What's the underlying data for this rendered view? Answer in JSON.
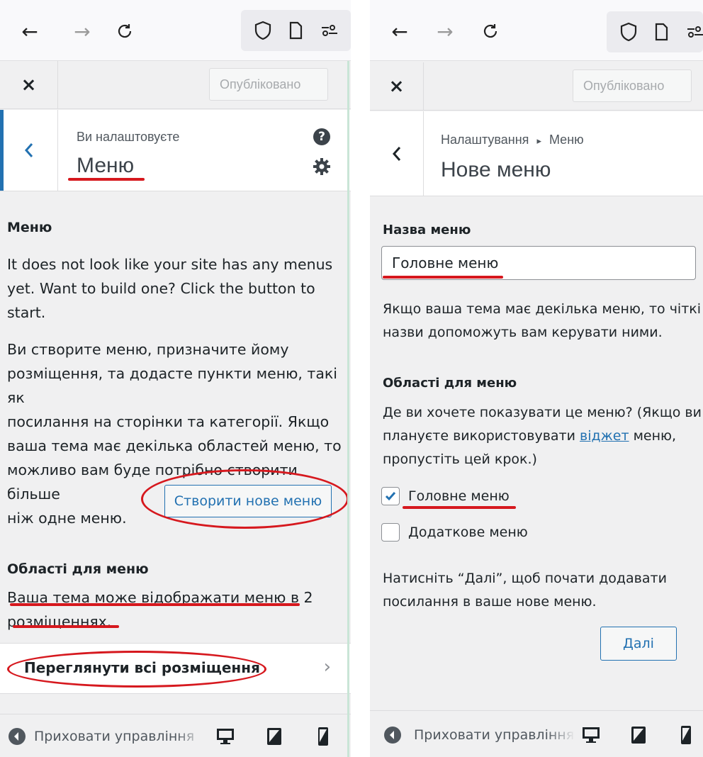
{
  "left_panel": {
    "header": {
      "close_label": "×",
      "published_label": "Опубліковано"
    },
    "section": {
      "subtitle": "Ви налаштовуєте",
      "title": "Меню"
    },
    "content": {
      "heading": "Меню",
      "paragraph1_lines": [
        "It does not look like your site has any menus",
        "yet. Want to build one? Click the button to",
        "start."
      ],
      "paragraph2_lines": [
        "Ви створите меню, призначите йому",
        "розміщення, та додасте пункти меню, такі як",
        "посилання на сторінки та категорії. Якщо",
        "ваша тема має декілька областей меню, то",
        "можливо вам буде потрібно створити більше",
        "ніж одне меню."
      ],
      "create_button_label": "Створити нове меню",
      "locations_heading": "Області для меню",
      "locations_lines": [
        "Ваша тема може відображати меню в 2",
        "розміщеннях."
      ],
      "view_all_label": "Переглянути всі розміщення"
    },
    "footer": {
      "hide_controls_label": "Приховати управління"
    }
  },
  "right_panel": {
    "header": {
      "close_label": "×",
      "published_label": "Опубліковано"
    },
    "section": {
      "breadcrumb_root": "Налаштування",
      "breadcrumb_sep": "▸",
      "breadcrumb_current": "Меню",
      "title": "Нове меню"
    },
    "content": {
      "name_label": "Назва меню",
      "name_value": "Головне меню",
      "name_help_lines": [
        "Якщо ваша тема має декілька меню, то чіткі",
        "назви допоможуть вам керувати ними."
      ],
      "locations_heading": "Області для меню",
      "locations_help_line1": "Де ви хочете показувати це меню? (Якщо ви",
      "locations_help_line2_pre": "плануєте використовувати ",
      "locations_help_link": "віджет",
      "locations_help_line2_post": " меню,",
      "locations_help_line3": "пропустіть цей крок.)",
      "location_options": [
        {
          "label": "Головне меню",
          "checked": true
        },
        {
          "label": "Додаткове меню",
          "checked": false
        }
      ],
      "next_help_lines": [
        "Натисніть “Далі”, щоб почати додавати",
        "посилання в ваше нове меню."
      ],
      "next_button_label": "Далі"
    },
    "footer": {
      "hide_controls_label": "Приховати управління"
    }
  },
  "colors": {
    "accent": "#2271b1",
    "annotation_red": "#d6181e",
    "panel_bg": "#f0f0f1"
  },
  "icons": [
    "back-arrow-icon",
    "forward-arrow-icon",
    "reload-icon",
    "shield-icon",
    "page-icon",
    "sliders-icon",
    "chevron-left-icon",
    "help-icon",
    "gear-icon",
    "chevron-right-icon",
    "collapse-icon",
    "desktop-icon",
    "tablet-icon",
    "mobile-icon",
    "checkmark-icon"
  ]
}
